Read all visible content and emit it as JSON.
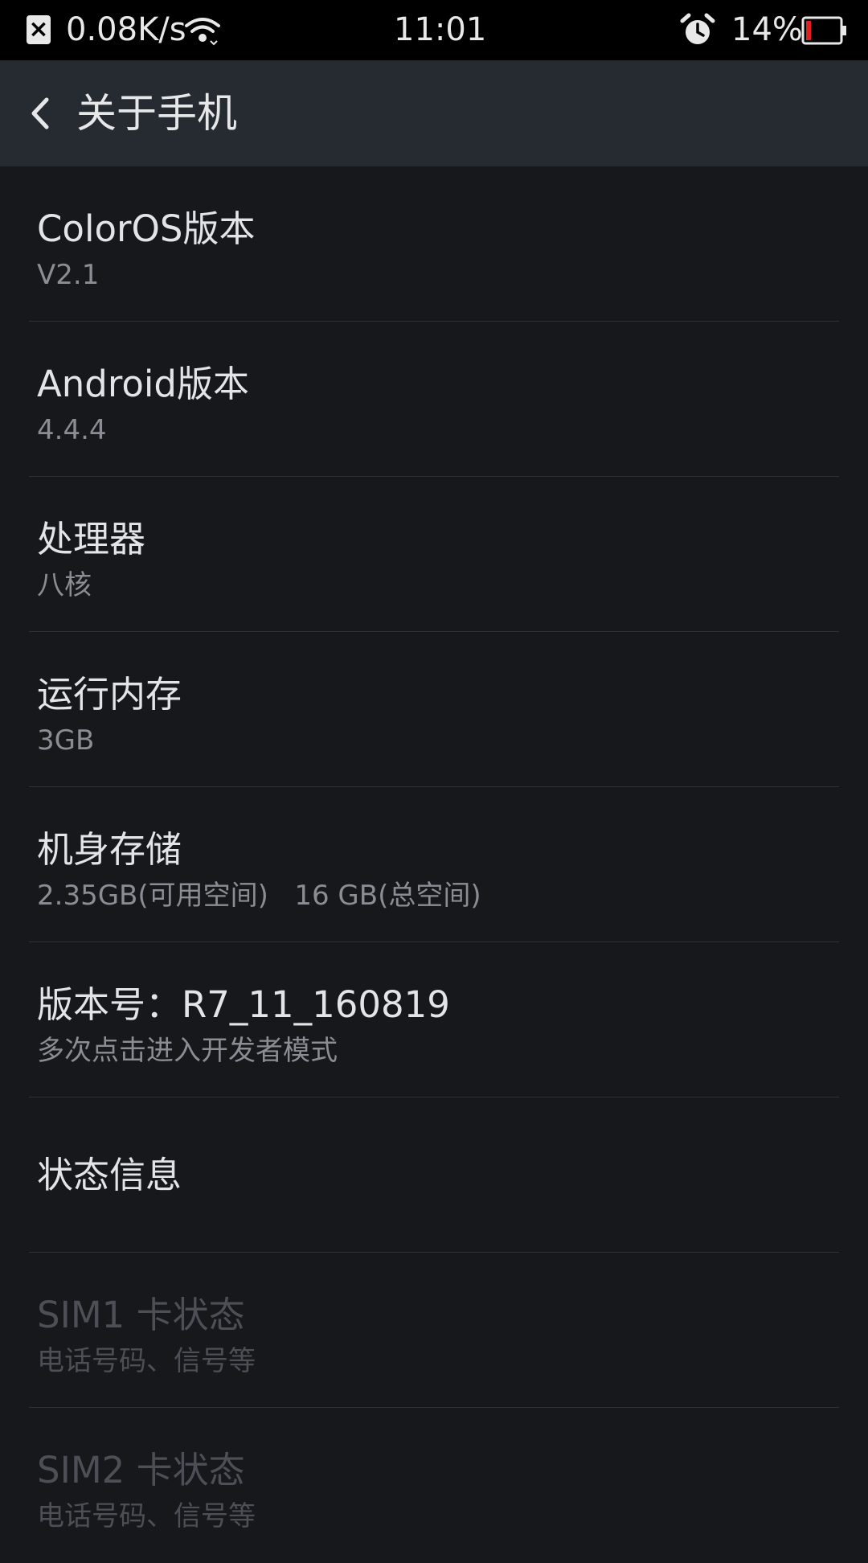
{
  "status_bar": {
    "net_speed": "0.08K/s",
    "time": "11:01",
    "battery_percent": "14%",
    "battery_level": 0.14,
    "battery_color": "#e02020",
    "icons": [
      "close-notification-icon",
      "wifi-icon",
      "alarm-icon",
      "battery-icon"
    ]
  },
  "header": {
    "title": "关于手机",
    "back_icon": "chevron-left-icon"
  },
  "items": [
    {
      "title": "ColorOS版本",
      "subtitle": "V2.1"
    },
    {
      "title": "Android版本",
      "subtitle": "4.4.4"
    },
    {
      "title": "处理器",
      "subtitle": "八核"
    },
    {
      "title": "运行内存",
      "subtitle": "3GB"
    },
    {
      "title": "机身存储",
      "subtitle": "2.35GB(可用空间)   16 GB(总空间)"
    },
    {
      "title": "版本号：R7_11_160819",
      "subtitle": "多次点击进入开发者模式"
    },
    {
      "title": "状态信息"
    },
    {
      "title": "SIM1 卡状态",
      "subtitle": "电话号码、信号等"
    },
    {
      "title": "SIM2 卡状态",
      "subtitle": "电话号码、信号等"
    }
  ]
}
